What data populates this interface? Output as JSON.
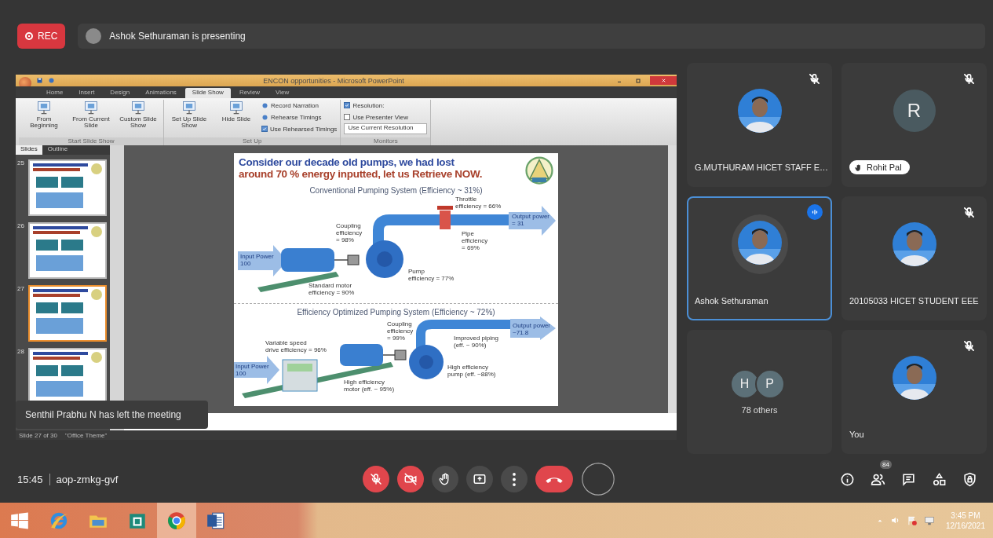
{
  "meeting": {
    "recording_label": "REC",
    "presenting_text": "Ashok Sethuraman is presenting"
  },
  "powerpoint": {
    "title": "ENCON opportunities - Microsoft PowerPoint",
    "ribbon_tabs": [
      {
        "label": "Home",
        "selected": false
      },
      {
        "label": "Insert",
        "selected": false
      },
      {
        "label": "Design",
        "selected": false
      },
      {
        "label": "Animations",
        "selected": false
      },
      {
        "label": "Slide Show",
        "selected": true
      },
      {
        "label": "Review",
        "selected": false
      },
      {
        "label": "View",
        "selected": false
      }
    ],
    "ribbon_groups": [
      {
        "label": "Start Slide Show",
        "items": [
          {
            "kind": "large",
            "label": "From Beginning"
          },
          {
            "kind": "large",
            "label": "From Current Slide"
          },
          {
            "kind": "large",
            "label": "Custom Slide Show"
          }
        ]
      },
      {
        "label": "Set Up",
        "items": [
          {
            "kind": "large",
            "label": "Set Up Slide Show"
          },
          {
            "kind": "large",
            "label": "Hide Slide"
          },
          {
            "kind": "small",
            "label": "Record Narration"
          },
          {
            "kind": "small",
            "label": "Rehearse Timings"
          },
          {
            "kind": "check",
            "label": "Use Rehearsed Timings",
            "checked": true
          }
        ]
      },
      {
        "label": "Monitors",
        "items": [
          {
            "kind": "check",
            "label": "Resolution:",
            "checked": true
          },
          {
            "kind": "check",
            "label": "Use Presenter View",
            "checked": false
          },
          {
            "kind": "select",
            "value": "Use Current Resolution"
          }
        ]
      }
    ],
    "panel_tabs": [
      {
        "label": "Slides",
        "selected": true
      },
      {
        "label": "Outline",
        "selected": false
      }
    ],
    "thumbnails": [
      {
        "number": "25",
        "selected": false
      },
      {
        "number": "26",
        "selected": false
      },
      {
        "number": "27",
        "selected": true
      },
      {
        "number": "28",
        "selected": false
      }
    ],
    "slide": {
      "title_lines": [
        "Consider our decade old pumps, we had lost",
        "around 70 % energy inputted, let us Retrieve NOW."
      ],
      "sections": [
        {
          "kind": "conventional",
          "heading": "Conventional Pumping System (Efficiency ~ 31%)",
          "labels": [
            {
              "lines": [
                "Throttle",
                "efficiency = 66%"
              ]
            },
            {
              "lines": [
                "Output power",
                "= 31"
              ]
            },
            {
              "lines": [
                "Coupling",
                "efficiency",
                "= 98%"
              ]
            },
            {
              "lines": [
                "Pipe",
                "efficiency",
                "= 69%"
              ]
            },
            {
              "lines": [
                "Input Power",
                "100"
              ]
            },
            {
              "lines": [
                "Pump",
                "efficiency = 77%"
              ]
            },
            {
              "lines": [
                "Standard motor",
                "efficiency = 90%"
              ]
            }
          ]
        },
        {
          "kind": "optimized",
          "heading": "Efficiency Optimized Pumping System (Efficiency ~ 72%)",
          "labels": [
            {
              "lines": [
                "Coupling",
                "efficiency",
                "= 99%"
              ]
            },
            {
              "lines": [
                "Output power",
                "~71.8"
              ]
            },
            {
              "lines": [
                "Improved piping",
                "(eff. ~ 90%)"
              ]
            },
            {
              "lines": [
                "Variable speed",
                "drive efficiency = 96%"
              ]
            },
            {
              "lines": [
                "Input Power",
                "100"
              ]
            },
            {
              "lines": [
                "High efficiency",
                "pump (eff. ~88%)"
              ]
            },
            {
              "lines": [
                "High efficiency",
                "motor (eff. ~ 95%)"
              ]
            }
          ]
        }
      ]
    },
    "status_bar": [
      "Slide 27 of 30",
      "\"Office Theme\""
    ]
  },
  "notification": "Senthil Prabhu N has left the meeting",
  "tiles": [
    {
      "name": "G.MUTHURAM HICET STAFF E…",
      "muted": true,
      "speaking": false,
      "raised_hand": false
    },
    {
      "kind": "initial",
      "initial": "R",
      "name": "Rohit Pal",
      "muted": true,
      "speaking": false,
      "raised_hand": true
    },
    {
      "name": "Ashok Sethuraman",
      "muted": false,
      "speaking": true,
      "raised_hand": false
    },
    {
      "name": "20105033 HICET STUDENT EEE",
      "muted": true,
      "speaking": false,
      "raised_hand": false
    },
    {
      "kind": "others",
      "initials": [
        "H",
        "P"
      ],
      "name": "78 others"
    },
    {
      "name": "You",
      "muted": true,
      "speaking": false,
      "raised_hand": false
    }
  ],
  "bottom_bar": {
    "time": "15:45",
    "meeting_code": "aop-zmkg-gvf",
    "controls": [
      {
        "kind": "mic",
        "off": true
      },
      {
        "kind": "camera",
        "off": true
      },
      {
        "kind": "hand",
        "off": false
      },
      {
        "kind": "present",
        "off": false
      },
      {
        "kind": "more",
        "off": false
      },
      {
        "kind": "end"
      },
      {
        "kind": "ring"
      }
    ],
    "side_controls": [
      {
        "kind": "info"
      },
      {
        "kind": "people",
        "badge": "84"
      },
      {
        "kind": "chat"
      },
      {
        "kind": "activities"
      },
      {
        "kind": "host"
      }
    ]
  },
  "taskbar": {
    "apps": [
      {
        "kind": "start",
        "active": false
      },
      {
        "kind": "browser",
        "active": false
      },
      {
        "kind": "files",
        "active": false
      },
      {
        "kind": "store",
        "active": false
      },
      {
        "kind": "chrome",
        "active": true
      },
      {
        "kind": "word",
        "active": false
      }
    ],
    "time": "3:45 PM",
    "date": "12/16/2021"
  }
}
